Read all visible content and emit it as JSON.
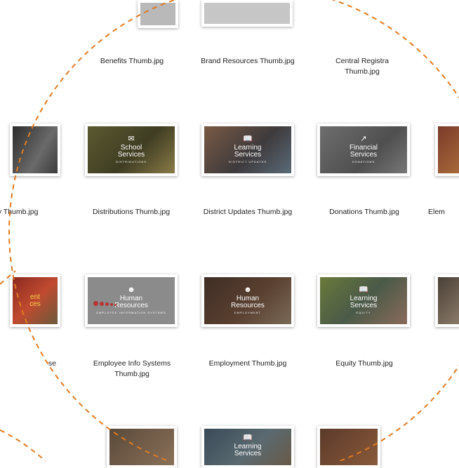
{
  "files": [
    {
      "id": "benefits",
      "caption": "Benefits Thumb.jpg"
    },
    {
      "id": "brand",
      "caption": "Brand Resources Thumb.jpg"
    },
    {
      "id": "central",
      "caption": "Central Registra\nThumb.jpg"
    },
    {
      "id": "security",
      "caption": "ity Thumb.jpg",
      "thumb": {
        "line1": "",
        "line2": "",
        "sub": ""
      }
    },
    {
      "id": "distributions",
      "caption": "Distributions Thumb.jpg",
      "thumb": {
        "icon": "envelope-icon",
        "line1": "School",
        "line2": "Services",
        "sub": "DISTRIBUTIONS"
      }
    },
    {
      "id": "district",
      "caption": "District Updates Thumb.jpg",
      "thumb": {
        "icon": "book-icon",
        "line1": "Learning",
        "line2": "Services",
        "sub": "DISTRICT UPDATES"
      }
    },
    {
      "id": "donations",
      "caption": "Donations Thumb.jpg",
      "thumb": {
        "icon": "chart-icon",
        "line1": "Financial",
        "line2": "Services",
        "sub": "DONATIONS"
      }
    },
    {
      "id": "elementary",
      "caption": "Elem"
    },
    {
      "id": "enterprise",
      "caption": "se",
      "thumb": {
        "line1": "ent",
        "line2": "ces",
        "sub": ""
      }
    },
    {
      "id": "empinfo",
      "caption": "Employee Info Systems\nThumb.jpg",
      "thumb": {
        "icon": "users-icon",
        "line1": "Human",
        "line2": "Resources",
        "sub": "EMPLOYEE INFORMATION SYSTEMS"
      }
    },
    {
      "id": "employment",
      "caption": "Employment Thumb.jpg",
      "thumb": {
        "icon": "users-icon",
        "line1": "Human",
        "line2": "Resources",
        "sub": "EMPLOYMENT"
      }
    },
    {
      "id": "equity",
      "caption": "Equity Thumb.jpg",
      "thumb": {
        "icon": "book-icon",
        "line1": "Learning",
        "line2": "Services",
        "sub": "EQUITY"
      }
    },
    {
      "id": "bottom-mid",
      "thumb": {
        "icon": "book-icon",
        "line1": "Learning",
        "line2": "Services",
        "sub": ""
      }
    }
  ],
  "colors": {
    "dash": "#e07b22",
    "hr": "#b73432"
  }
}
